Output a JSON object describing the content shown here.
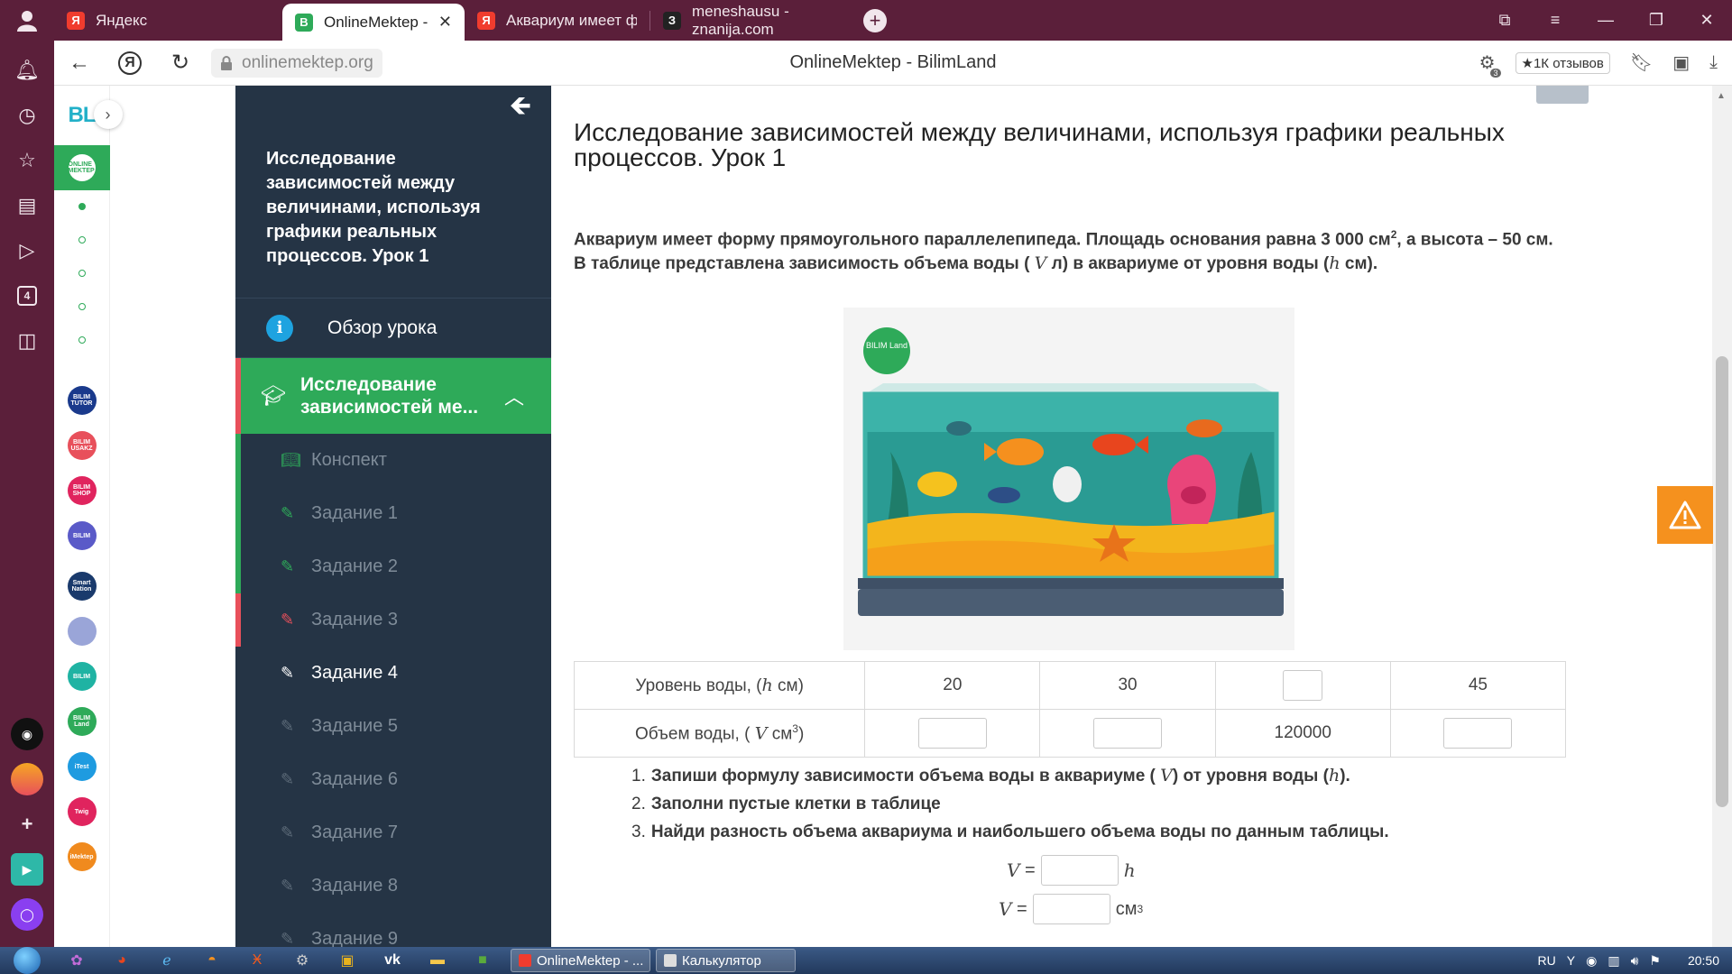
{
  "browser": {
    "tabs": [
      {
        "label": "Яндекс",
        "favicon": "yandex-icon",
        "color": "#f03c2e",
        "active": false
      },
      {
        "label": "OnlineMektep - BilimLand",
        "favicon": "bilimland-icon",
        "color": "#2eaa59",
        "active": true
      },
      {
        "label": "Аквариум имеет форму пр",
        "favicon": "yandex-icon",
        "color": "#f03c2e",
        "active": false
      },
      {
        "label": "meneshausu - znanija.com",
        "favicon": "znanija-icon",
        "color": "#222222",
        "active": false
      }
    ],
    "url": "onlinemektep.org",
    "page_title": "OnlineMektep - BilimLand",
    "reviews_label": "★1К отзывов",
    "extension_badge": "3",
    "rail_badge": "4"
  },
  "bilimland": {
    "logo": "BL",
    "active_app_label": "ONLINE MEKTEP",
    "apps": [
      {
        "label": "BILIM TUTOR",
        "color": "#1a3a8c"
      },
      {
        "label": "BILIM USAKZ",
        "color": "#e8505b"
      },
      {
        "label": "BILIM SHOP",
        "color": "#e0245e"
      },
      {
        "label": "BILIM",
        "color": "#5a5ac8"
      },
      {
        "label": "Smart Nation",
        "color": "#1a3a6c"
      },
      {
        "label": "",
        "color": "#9aa5d8"
      },
      {
        "label": "BILIM",
        "color": "#1fb3a3"
      },
      {
        "label": "BILIM Land",
        "color": "#2eaa59"
      },
      {
        "label": "iTest",
        "color": "#1e9be0"
      },
      {
        "label": "Twig",
        "color": "#e0245e"
      },
      {
        "label": "iMektep",
        "color": "#f08a1e"
      }
    ]
  },
  "lesson": {
    "title": "Исследование зависимостей между величинами, используя графики реальных процессов. Урок 1",
    "overview": "Обзор урока",
    "section": "Исследование зависимостей ме...",
    "items": [
      {
        "label": "Конспект",
        "status": "green",
        "icon": "book-icon"
      },
      {
        "label": "Задание 1",
        "status": "green",
        "icon": "edit-icon"
      },
      {
        "label": "Задание 2",
        "status": "green",
        "icon": "edit-icon"
      },
      {
        "label": "Задание 3",
        "status": "red",
        "icon": "edit-icon"
      },
      {
        "label": "Задание 4",
        "status": "current",
        "icon": "edit-icon"
      },
      {
        "label": "Задание 5",
        "status": "none",
        "icon": "edit-icon"
      },
      {
        "label": "Задание 6",
        "status": "none",
        "icon": "edit-icon"
      },
      {
        "label": "Задание 7",
        "status": "none",
        "icon": "edit-icon"
      },
      {
        "label": "Задание 8",
        "status": "none",
        "icon": "edit-icon"
      },
      {
        "label": "Задание 9",
        "status": "none",
        "icon": "edit-icon"
      }
    ]
  },
  "main": {
    "heading": "Исследование зависимостей между величинами, используя графики реальных процессов. Урок 1",
    "problem": {
      "p1": "Аквариум имеет форму прямоугольного параллелепипеда. Площадь основания равна 3 000 см",
      "p1_sup": "2",
      "p2": ", а высота – 50 см. В таблице представлена зависимость объема воды ( ",
      "var_v": "V",
      "p3": " л) в аквариуме от уровня воды (",
      "var_h": "h",
      "p4": " см)."
    },
    "illustration_logo": "BILIM Land",
    "table": {
      "row1_label_a": "Уровень воды, (",
      "row1_var": "h",
      "row1_label_b": " см)",
      "row2_label_a": "Объем воды, ( ",
      "row2_var": "V",
      "row2_label_b": " см",
      "row2_sup": "3",
      "row2_label_c": ")",
      "row1": [
        "20",
        "30",
        "",
        "45"
      ],
      "row2": [
        "",
        "",
        "120000",
        ""
      ]
    },
    "questions": [
      {
        "num": "1.",
        "text_a": "Запиши формулу зависимости объема воды в аквариуме ( ",
        "var1": "V",
        "text_b": ") от уровня воды (",
        "var2": "h",
        "text_c": ")."
      },
      {
        "num": "2.",
        "text_a": "Заполни пустые клетки в таблице"
      },
      {
        "num": "3.",
        "text_a": "Найди разность объема аквариума и наибольшего объема воды по данным таблицы."
      }
    ],
    "formula1": {
      "lhs": "V",
      "eq": "=",
      "rhs": "h"
    },
    "formula2": {
      "lhs": "V",
      "eq": "=",
      "unit": "см",
      "sup": "3"
    }
  },
  "taskbar": {
    "windows": [
      "OnlineMektep - ...",
      "Калькулятор"
    ],
    "lang": "RU",
    "time": "20:50"
  }
}
